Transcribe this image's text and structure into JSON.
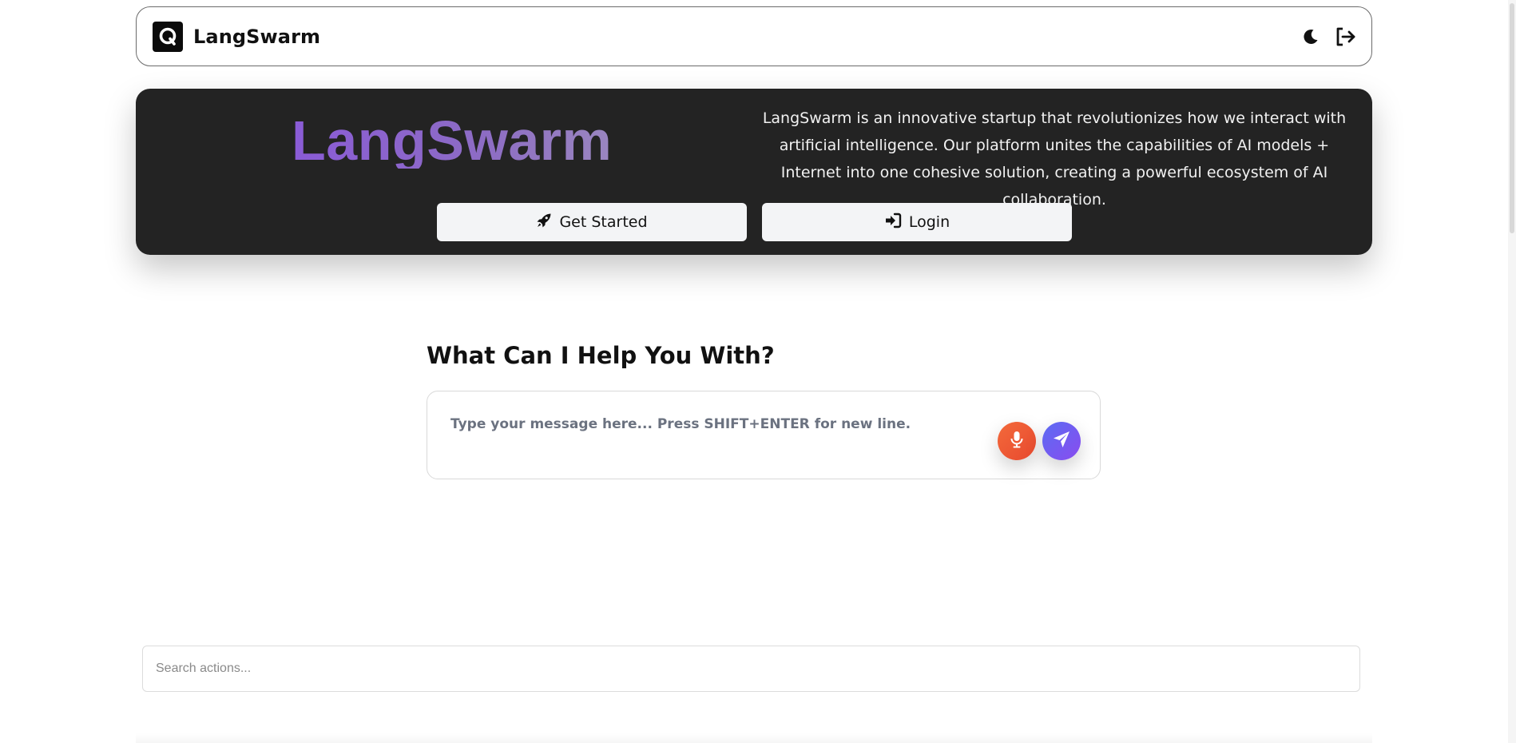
{
  "navbar": {
    "brand": "LangSwarm",
    "logo_letter": "Q",
    "icons": [
      "moon-icon",
      "logout-icon"
    ]
  },
  "hero": {
    "title": "LangSwarm",
    "description": "LangSwarm is an innovative startup that revolutionizes how we interact with artificial intelligence. Our platform unites the capabilities of AI models + Internet into one cohesive solution, creating a powerful ecosystem of AI collaboration.",
    "get_started_label": "Get Started",
    "login_label": "Login"
  },
  "chat": {
    "heading": "What Can I Help You With?",
    "placeholder": "Type your message here... Press SHIFT+ENTER for new line.",
    "value": ""
  },
  "search": {
    "placeholder": "Search actions...",
    "value": ""
  },
  "colors": {
    "hero_bg": "#232323",
    "mic_button": "#ee5a35",
    "send_button": "#6d5cf1",
    "title_gradient_start": "#8a5bd6",
    "title_gradient_end": "#9a86c0"
  }
}
